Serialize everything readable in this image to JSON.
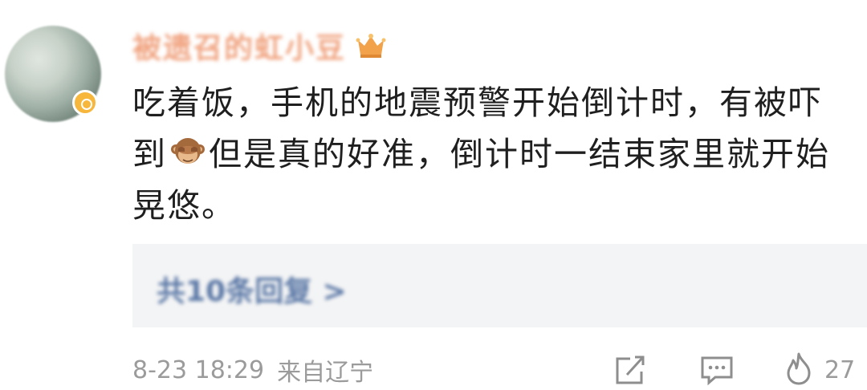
{
  "user": {
    "name": "被遗召的虹小豆",
    "avatar_icon": "avatar-image",
    "badge_icon": "verified-badge-icon",
    "crown_icon": "crown-icon"
  },
  "comment": {
    "text_part1": "吃着饭，手机的地震预警开始倒计时，有被吓到",
    "emoji": "see-no-evil-monkey-emoji",
    "text_part2": "但是真的好准，倒计时一结束家里就开始晃悠。"
  },
  "replies": {
    "label": "共10条回复 >"
  },
  "footer": {
    "timestamp": "8-23 18:29",
    "source": "来自辽宁",
    "share_icon": "share-icon",
    "comment_icon": "comment-icon",
    "like_icon": "flame-icon",
    "like_count": "27"
  },
  "colors": {
    "username": "#f0a27e",
    "text": "#1f1f1f",
    "meta": "#9b9b9b",
    "replies_bg": "#f3f4f5",
    "replies_link": "#5b78a6"
  }
}
